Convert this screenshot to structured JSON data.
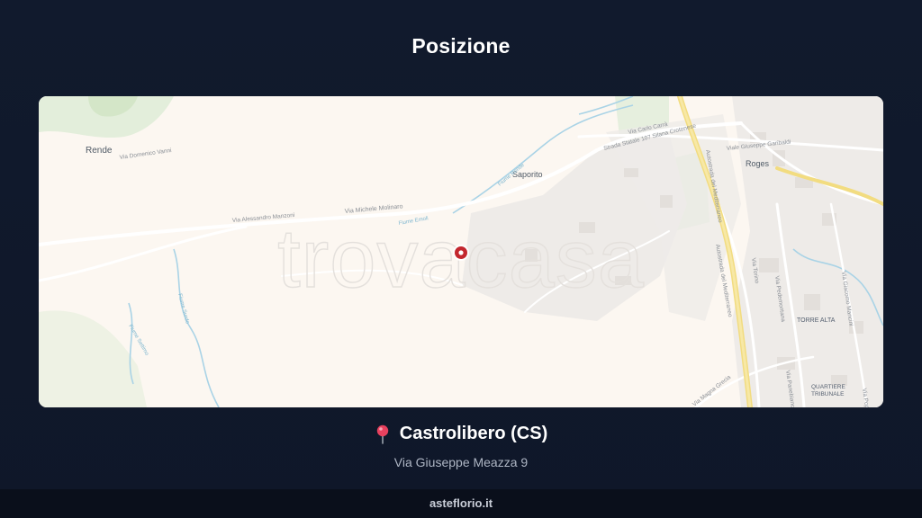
{
  "page": {
    "title": "Posizione"
  },
  "map": {
    "watermark": "trovacasa",
    "labels": {
      "rende": "Rende",
      "via_domenico_vanni": "Via Domenico Vanni",
      "saporito": "Saporito",
      "roges": "Roges",
      "via_carlo_carra": "Via Carlo Carrà",
      "strada_statale": "Strada Statale 107 Silana Crotonese",
      "viale_garibaldi": "Viale Giuseppe Garibaldi",
      "via_alessandro_manzoni": "Via Alessandro Manzoni",
      "via_michele_molinaro": "Via Michele Molinaro",
      "fiume_emoli": "Fiume Emoli",
      "fiume_surdo": "Fiume Surdo",
      "fiume_settimo": "Fiume Settimo",
      "fiume_rende": "Fiume Rende",
      "autostrada_1": "Autostrada del Mediterraneo",
      "autostrada_2": "Autostrada del Mediterraneo",
      "via_torino": "Via Torino",
      "via_pedemontana": "Via Pedemontana",
      "via_giacomo_mancini": "Via Giacomo Mancini",
      "via_magna_grecia": "Via Magna Grecia",
      "via_panebianco": "Via Panebianco",
      "torre_alta": "TORRE ALTA",
      "quartiere": "QUARTIERE",
      "tribunale": "TRIBUNALE",
      "via_popilia": "Via Popilia"
    },
    "colors": {
      "land": "#fcf7f1",
      "green": "#d9ead0",
      "water": "#a9d3e6",
      "highway": "#f3e08a",
      "road": "#ffffff",
      "marker": "#c3272e"
    }
  },
  "location": {
    "pin_icon": "round-pushpin-icon",
    "city": "Castrolibero (CS)",
    "address": "Via Giuseppe Meazza 9"
  },
  "footer": {
    "text": "asteflorio.it"
  }
}
